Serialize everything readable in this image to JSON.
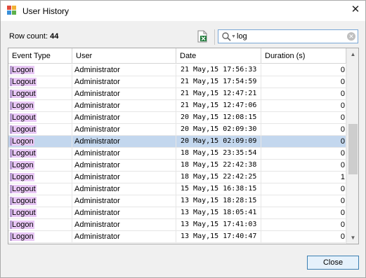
{
  "window": {
    "title": "User History"
  },
  "toolbar": {
    "row_count_label": "Row count:",
    "row_count_value": "44",
    "export_icon": "excel-export-icon",
    "search_value": "log",
    "search_placeholder": ""
  },
  "grid": {
    "columns": [
      "Event Type",
      "User",
      "Date",
      "Duration (s)"
    ],
    "rows": [
      {
        "type": "Logon",
        "user": "Administrator",
        "date": "21 May,15 17:56:33",
        "duration": "0"
      },
      {
        "type": "Logout",
        "user": "Administrator",
        "date": "21 May,15 17:54:59",
        "duration": "0"
      },
      {
        "type": "Logout",
        "user": "Administrator",
        "date": "21 May,15 12:47:21",
        "duration": "0"
      },
      {
        "type": "Logon",
        "user": "Administrator",
        "date": "21 May,15 12:47:06",
        "duration": "0"
      },
      {
        "type": "Logout",
        "user": "Administrator",
        "date": "20 May,15 12:08:15",
        "duration": "0"
      },
      {
        "type": "Logout",
        "user": "Administrator",
        "date": "20 May,15 02:09:30",
        "duration": "0"
      },
      {
        "type": "Logon",
        "user": "Administrator",
        "date": "20 May,15 02:09:09",
        "duration": "0",
        "selected": true
      },
      {
        "type": "Logout",
        "user": "Administrator",
        "date": "18 May,15 23:35:54",
        "duration": "0"
      },
      {
        "type": "Logon",
        "user": "Administrator",
        "date": "18 May,15 22:42:38",
        "duration": "0"
      },
      {
        "type": "Logon",
        "user": "Administrator",
        "date": "18 May,15 22:42:25",
        "duration": "1"
      },
      {
        "type": "Logout",
        "user": "Administrator",
        "date": "15 May,15 16:38:15",
        "duration": "0"
      },
      {
        "type": "Logout",
        "user": "Administrator",
        "date": "13 May,15 18:28:15",
        "duration": "0"
      },
      {
        "type": "Logout",
        "user": "Administrator",
        "date": "13 May,15 18:05:41",
        "duration": "0"
      },
      {
        "type": "Logon",
        "user": "Administrator",
        "date": "13 May,15 17:41:03",
        "duration": "0"
      },
      {
        "type": "Logon",
        "user": "Administrator",
        "date": "13 May,15 17:40:47",
        "duration": "0"
      }
    ]
  },
  "footer": {
    "close_label": "Close"
  },
  "colors": {
    "selection": "#c3d7ee",
    "highlight": "#e8c7f5",
    "accent": "#3c7fb1"
  }
}
